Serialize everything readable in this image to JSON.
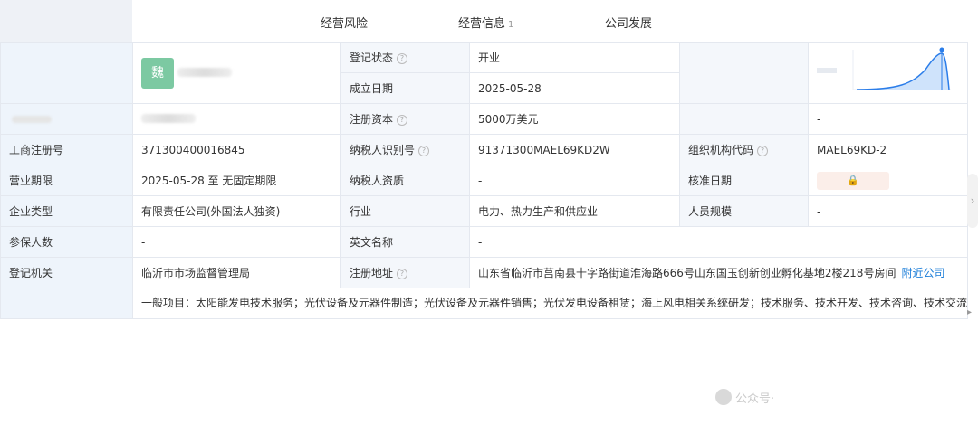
{
  "tabs": [
    {
      "label": "经营风险",
      "badge": ""
    },
    {
      "label": "经营信息",
      "badge": "1"
    },
    {
      "label": "公司发展",
      "badge": ""
    }
  ],
  "seal": {
    "text": "魏"
  },
  "rows": {
    "reg_status": {
      "label": "登记状态",
      "value": "开业"
    },
    "found_date": {
      "label": "成立日期",
      "value": "2025-05-28"
    },
    "reg_capital": {
      "label": "注册资本",
      "value": "5000万美元",
      "right_value": "-"
    },
    "biz_reg_no": {
      "label": "工商注册号",
      "value": "371300400016845"
    },
    "taxpayer_id": {
      "label": "纳税人识别号",
      "value": "91371300MAEL69KD2W"
    },
    "org_code": {
      "label": "组织机构代码",
      "value": "MAEL69KD-2"
    },
    "biz_term": {
      "label": "营业期限",
      "value": "2025-05-28 至 无固定期限"
    },
    "taxpayer_qual": {
      "label": "纳税人资质",
      "value": "-"
    },
    "approval_date": {
      "label": "核准日期"
    },
    "ent_type": {
      "label": "企业类型",
      "value": "有限责任公司(外国法人独资)"
    },
    "industry": {
      "label": "行业",
      "value": "电力、热力生产和供应业"
    },
    "staff_size": {
      "label": "人员规模",
      "value": "-"
    },
    "insured": {
      "label": "参保人数",
      "value": "-"
    },
    "en_name": {
      "label": "英文名称",
      "value": "-"
    },
    "reg_authority": {
      "label": "登记机关",
      "value": "临沂市市场监督管理局"
    },
    "reg_address": {
      "label": "注册地址",
      "value": "山东省临沂市莒南县十字路街道淮海路666号山东国玉创新创业孵化基地2楼218号房间",
      "link": "附近公司"
    }
  },
  "scope": "一般项目：太阳能发电技术服务；光伏设备及元器件制造；光伏设备及元器件销售；光伏发电设备租赁；海上风电相关系统研发；技术服务、技术开发、技术咨询、技术交流、技术转让、技术推广；发电技术服务；太阳能热利用装备销售；太阳能热发电装备销售；太阳能热发电产品销售；新能源原动设备制造；新能源原动设备销售；工程管理服务；新能源汽车电附件销售；新能源汽车整车销售；新能源汽车换电设施销售；新能源汽车生产测试设备销售；新能源汽车废旧动力蓄电池回收及梯次利用（不含危险废物经营）；储能技术服务；电力行业高效节能技术研发；风力发电技术服务；风力发电机组及零部件销售；电力电子元器件销售；电力设施器材销售；余热余压余气利用技术研发；新兴能源技术研发；合同能源管理；输配电及控制设备制造；电线、电缆经营；电力电子元器件制造；电子元器件与机电组件设备制造；电子元器件与机电组件设备销售；建筑装饰材料销售；日用杂品销售；办公用品销售；办公服务；租赁服务（不含许可类租赁服务）。（除依法须经批准的项目外，凭营业执照依法自主开展经营活动）许可项目：发电业务、输电业务、供（配）电业务；建设工程施工；建设工程设计。（依法须经批准的项目，经相关部门批准后方可开展经营活动，具体经营项目以相关部门批准文件或许可证件为准）",
  "watermark": "公众号·"
}
